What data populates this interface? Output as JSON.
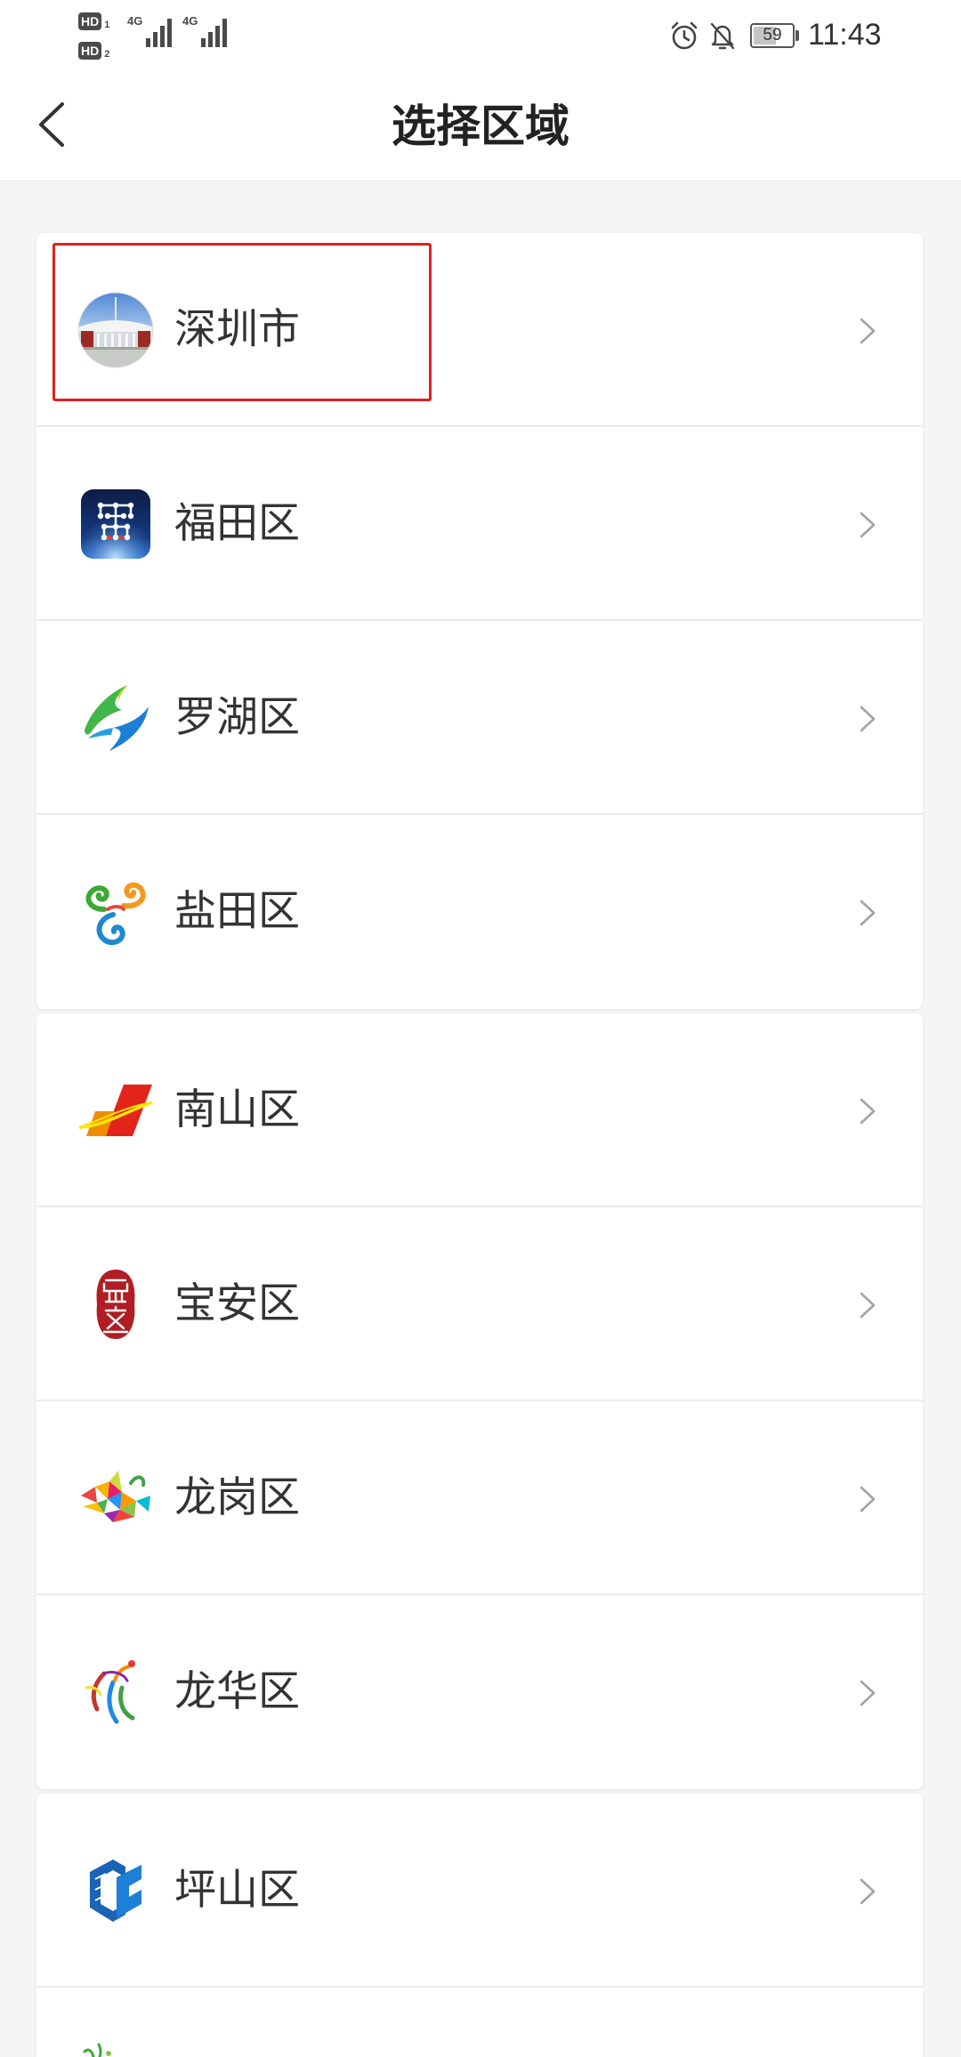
{
  "status_bar": {
    "sim1": {
      "label": "HD",
      "slot": "1"
    },
    "sim2": {
      "label": "HD",
      "slot": "2"
    },
    "network1": "4G",
    "network2": "4G",
    "signal_icon": "signal-bars-icon",
    "alarm_icon": "alarm-icon",
    "notification_icon": "notifications-off-icon",
    "battery_icon": "battery-icon",
    "battery_level": "59",
    "time": "11:43"
  },
  "header": {
    "back_icon": "chevron-left-icon",
    "title": "选择区域"
  },
  "row_chevron_icon": "chevron-right-icon",
  "region_groups": [
    {
      "items": [
        {
          "label": "深圳市",
          "icon": "shenzhen-civic-center-icon"
        },
        {
          "label": "福田区",
          "icon": "futian-logo-icon"
        },
        {
          "label": "罗湖区",
          "icon": "luohu-logo-icon"
        },
        {
          "label": "盐田区",
          "icon": "yantian-logo-icon"
        }
      ]
    },
    {
      "items": [
        {
          "label": "南山区",
          "icon": "nanshan-logo-icon"
        },
        {
          "label": "宝安区",
          "icon": "baoan-logo-icon"
        },
        {
          "label": "龙岗区",
          "icon": "longgang-logo-icon"
        },
        {
          "label": "龙华区",
          "icon": "longhua-logo-icon"
        }
      ]
    },
    {
      "items": [
        {
          "label": "坪山区",
          "icon": "pingshan-logo-icon"
        },
        {
          "icon": "green-logo-icon"
        }
      ]
    }
  ],
  "highlight_color": "#e02020",
  "colors": {
    "page_background": "#f5f5f5",
    "card_background": "#ffffff",
    "text": "#333333",
    "title": "#222222",
    "chevron": "#a3a3a3",
    "divider": "#ebebeb"
  }
}
